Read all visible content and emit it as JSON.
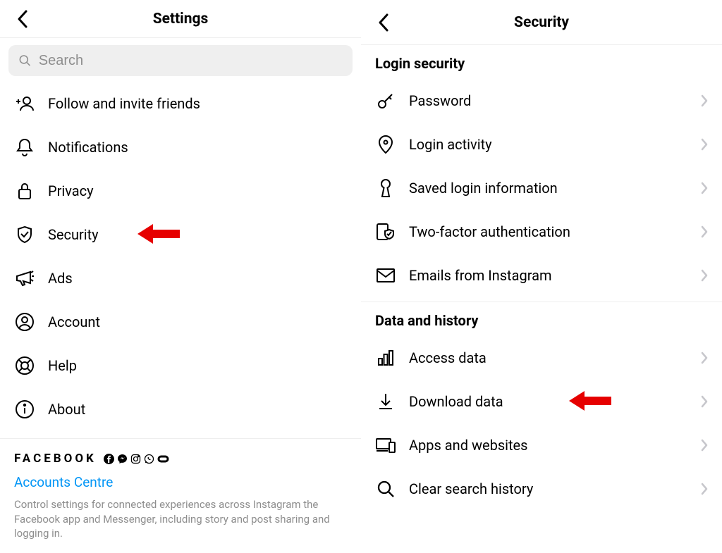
{
  "left": {
    "title": "Settings",
    "search_placeholder": "Search",
    "items": [
      {
        "label": "Follow and invite friends"
      },
      {
        "label": "Notifications"
      },
      {
        "label": "Privacy"
      },
      {
        "label": "Security"
      },
      {
        "label": "Ads"
      },
      {
        "label": "Account"
      },
      {
        "label": "Help"
      },
      {
        "label": "About"
      }
    ],
    "footer": {
      "brand": "FACEBOOK",
      "link": "Accounts Centre",
      "description": "Control settings for connected experiences across Instagram the Facebook app and Messenger, including story and post sharing and logging in."
    }
  },
  "right": {
    "title": "Security",
    "sections": [
      {
        "title": "Login security",
        "items": [
          {
            "label": "Password"
          },
          {
            "label": "Login activity"
          },
          {
            "label": "Saved login information"
          },
          {
            "label": "Two-factor authentication"
          },
          {
            "label": "Emails from Instagram"
          }
        ]
      },
      {
        "title": "Data and history",
        "items": [
          {
            "label": "Access data"
          },
          {
            "label": "Download data"
          },
          {
            "label": "Apps and websites"
          },
          {
            "label": "Clear search history"
          }
        ]
      }
    ]
  }
}
